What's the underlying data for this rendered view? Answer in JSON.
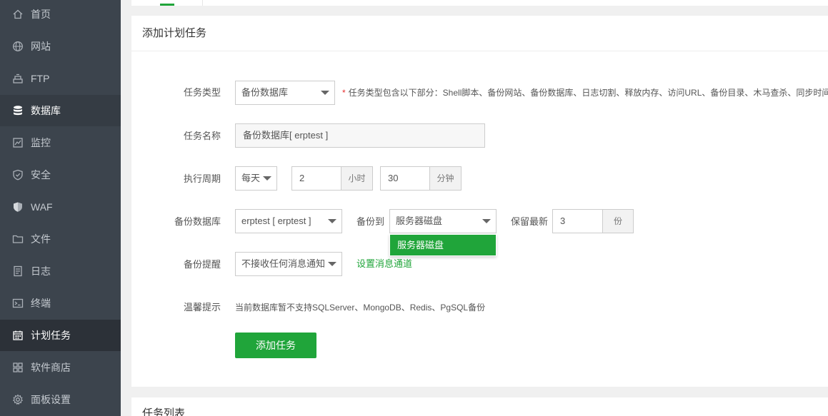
{
  "sidebar": {
    "items": [
      {
        "label": "首页",
        "icon": "home-icon"
      },
      {
        "label": "网站",
        "icon": "globe-icon"
      },
      {
        "label": "FTP",
        "icon": "ftp-icon"
      },
      {
        "label": "数据库",
        "icon": "database-icon"
      },
      {
        "label": "监控",
        "icon": "monitor-icon"
      },
      {
        "label": "安全",
        "icon": "shield-icon"
      },
      {
        "label": "WAF",
        "icon": "waf-shield-icon"
      },
      {
        "label": "文件",
        "icon": "folder-icon"
      },
      {
        "label": "日志",
        "icon": "log-icon"
      },
      {
        "label": "终端",
        "icon": "terminal-icon"
      },
      {
        "label": "计划任务",
        "icon": "calendar-icon"
      },
      {
        "label": "软件商店",
        "icon": "apps-grid-icon"
      },
      {
        "label": "面板设置",
        "icon": "gear-icon"
      }
    ]
  },
  "form": {
    "title": "添加计划任务",
    "task_type_label": "任务类型",
    "task_type_value": "备份数据库",
    "task_type_hint": "任务类型包含以下部分：Shell脚本、备份网站、备份数据库、日志切割、释放内存、访问URL、备份目录、木马查杀、同步时间",
    "task_type_hint_star": "*",
    "task_name_label": "任务名称",
    "task_name_value": "备份数据库[ erptest ]",
    "cycle_label": "执行周期",
    "cycle_value": "每天",
    "hour_value": "2",
    "hour_unit": "小时",
    "minute_value": "30",
    "minute_unit": "分钟",
    "backup_db_label": "备份数据库",
    "backup_db_value": "erptest [ erptest ]",
    "backup_to_label": "备份到",
    "backup_to_value": "服务器磁盘",
    "backup_to_option": "服务器磁盘",
    "keep_label": "保留最新",
    "keep_value": "3",
    "keep_unit": "份",
    "notify_label": "备份提醒",
    "notify_value": "不接收任何消息通知",
    "notify_link": "设置消息通道",
    "tip_label": "温馨提示",
    "tip_text": "当前数据库暂不支持SQLServer、MongoDB、Redis、PgSQL备份",
    "submit_label": "添加任务"
  },
  "task_list": {
    "title": "任务列表"
  },
  "colors": {
    "accent": "#20a53a",
    "sidebar_bg": "#3c444d",
    "sidebar_active": "#2c3138"
  }
}
